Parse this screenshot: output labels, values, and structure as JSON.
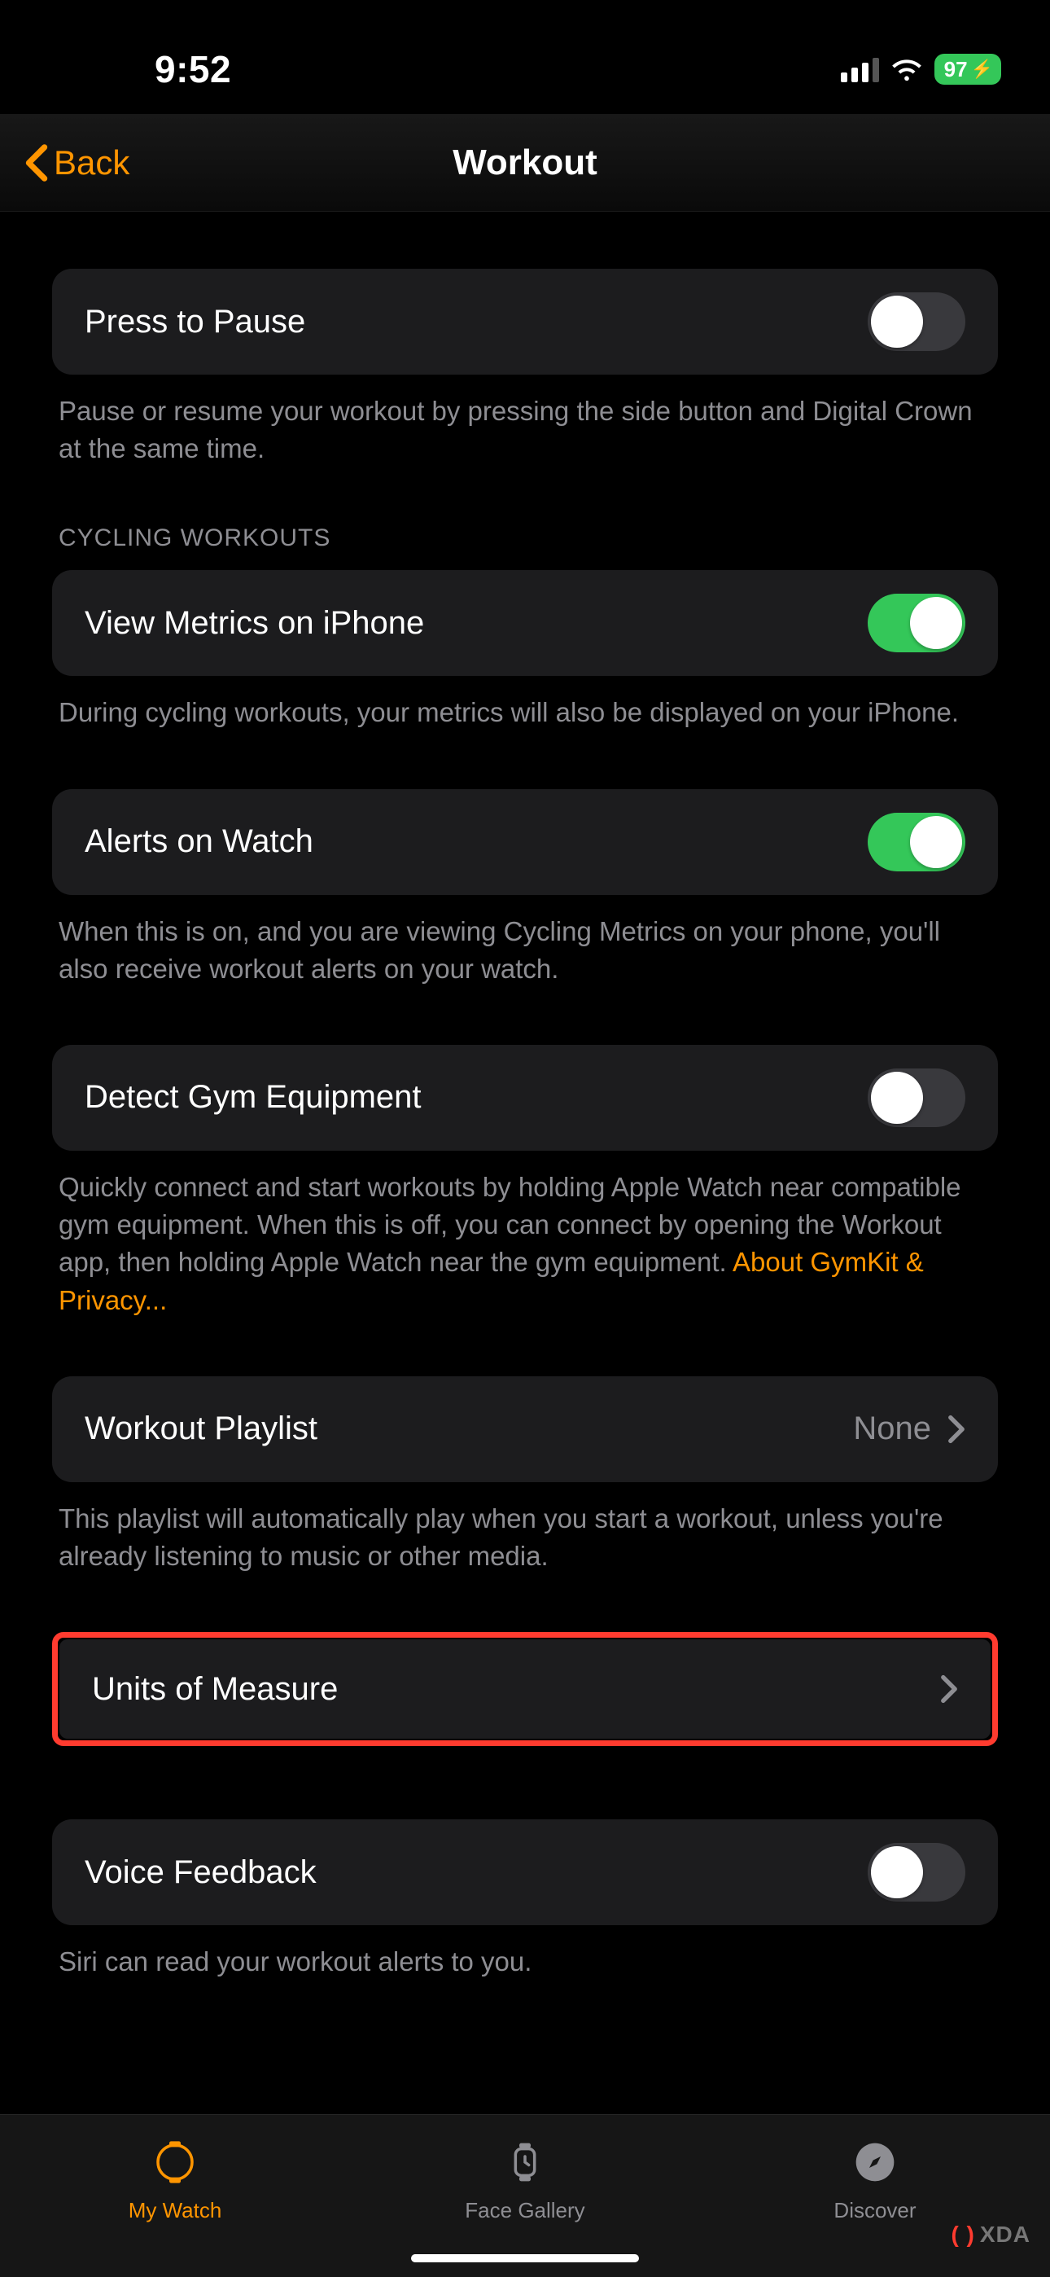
{
  "status": {
    "time": "9:52",
    "battery_text": "97"
  },
  "nav": {
    "back_label": "Back",
    "title": "Workout"
  },
  "rows": {
    "press_to_pause": {
      "label": "Press to Pause",
      "footer": "Pause or resume your workout by pressing the side button and Digital Crown at the same time.",
      "on": false
    },
    "cycling_header": "CYCLING WORKOUTS",
    "view_metrics": {
      "label": "View Metrics on iPhone",
      "footer": "During cycling workouts, your metrics will also be displayed on your iPhone.",
      "on": true
    },
    "alerts_on_watch": {
      "label": "Alerts on Watch",
      "footer": "When this is on, and you are viewing Cycling Metrics on your phone, you'll also receive workout alerts on your watch.",
      "on": true
    },
    "detect_gym": {
      "label": "Detect Gym Equipment",
      "footer_prefix": "Quickly connect and start workouts by holding Apple Watch near compatible gym equipment. When this is off, you can connect by opening the Workout app, then holding Apple Watch near the gym equipment. ",
      "footer_link": "About GymKit & Privacy...",
      "on": false
    },
    "workout_playlist": {
      "label": "Workout Playlist",
      "value": "None",
      "footer": "This playlist will automatically play when you start a workout, unless you're already listening to music or other media."
    },
    "units_of_measure": {
      "label": "Units of Measure"
    },
    "voice_feedback": {
      "label": "Voice Feedback",
      "footer": "Siri can read your workout alerts to you.",
      "on": false
    }
  },
  "tabs": {
    "my_watch": "My Watch",
    "face_gallery": "Face Gallery",
    "discover": "Discover"
  },
  "brand": "XDA"
}
